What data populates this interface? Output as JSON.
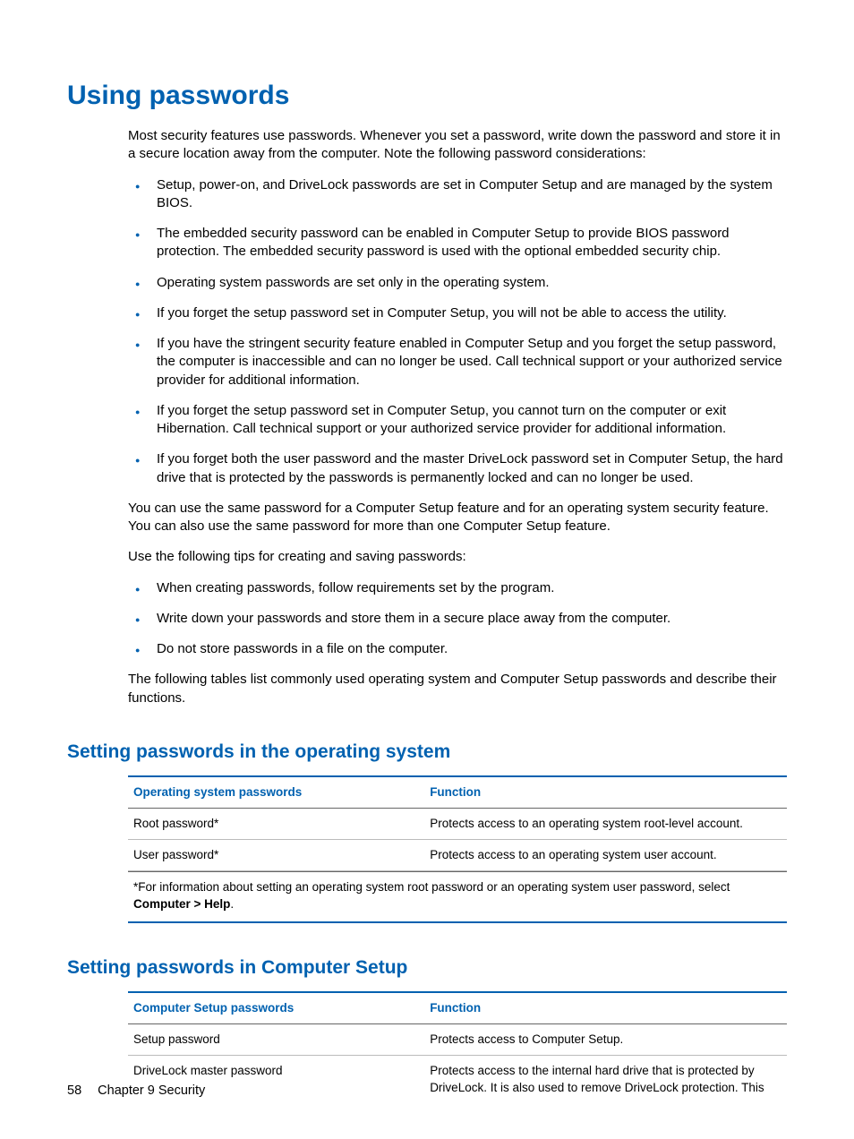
{
  "h1": "Using passwords",
  "intro": "Most security features use passwords. Whenever you set a password, write down the password and store it in a secure location away from the computer. Note the following password considerations:",
  "bullets1": [
    "Setup, power-on, and DriveLock passwords are set in Computer Setup and are managed by the system BIOS.",
    "The embedded security password can be enabled in Computer Setup to provide BIOS password protection. The embedded security password is used with the optional embedded security chip.",
    "Operating system passwords are set only in the operating system.",
    "If you forget the setup password set in Computer Setup, you will not be able to access the utility.",
    "If you have the stringent security feature enabled in Computer Setup and you forget the setup password, the computer is inaccessible and can no longer be used. Call technical support or your authorized service provider for additional information.",
    "If you forget the setup password set in Computer Setup, you cannot turn on the computer or exit Hibernation. Call technical support or your authorized service provider for additional information.",
    "If you forget both the user password and the master DriveLock password set in Computer Setup, the hard drive that is protected by the passwords is permanently locked and can no longer be used."
  ],
  "para2": "You can use the same password for a Computer Setup feature and for an operating system security feature. You can also use the same password for more than one Computer Setup feature.",
  "para3": "Use the following tips for creating and saving passwords:",
  "bullets2": [
    "When creating passwords, follow requirements set by the program.",
    "Write down your passwords and store them in a secure place away from the computer.",
    "Do not store passwords in a file on the computer."
  ],
  "para4": "The following tables list commonly used operating system and Computer Setup passwords and describe their functions.",
  "h2a": "Setting passwords in the operating system",
  "table1": {
    "headers": [
      "Operating system passwords",
      "Function"
    ],
    "rows": [
      [
        "Root password*",
        "Protects access to an operating system root-level account."
      ],
      [
        "User password*",
        "Protects access to an operating system user account."
      ]
    ],
    "footnote_pre": "*For information about setting an operating system root password or an operating system user password, select ",
    "footnote_bold": "Computer > Help",
    "footnote_post": "."
  },
  "h2b": "Setting passwords in Computer Setup",
  "table2": {
    "headers": [
      "Computer Setup passwords",
      "Function"
    ],
    "rows": [
      [
        "Setup password",
        "Protects access to Computer Setup."
      ],
      [
        "DriveLock master password",
        "Protects access to the internal hard drive that is protected by DriveLock. It is also used to remove DriveLock protection. This"
      ]
    ]
  },
  "footer": {
    "page": "58",
    "chapter": "Chapter 9   Security"
  }
}
